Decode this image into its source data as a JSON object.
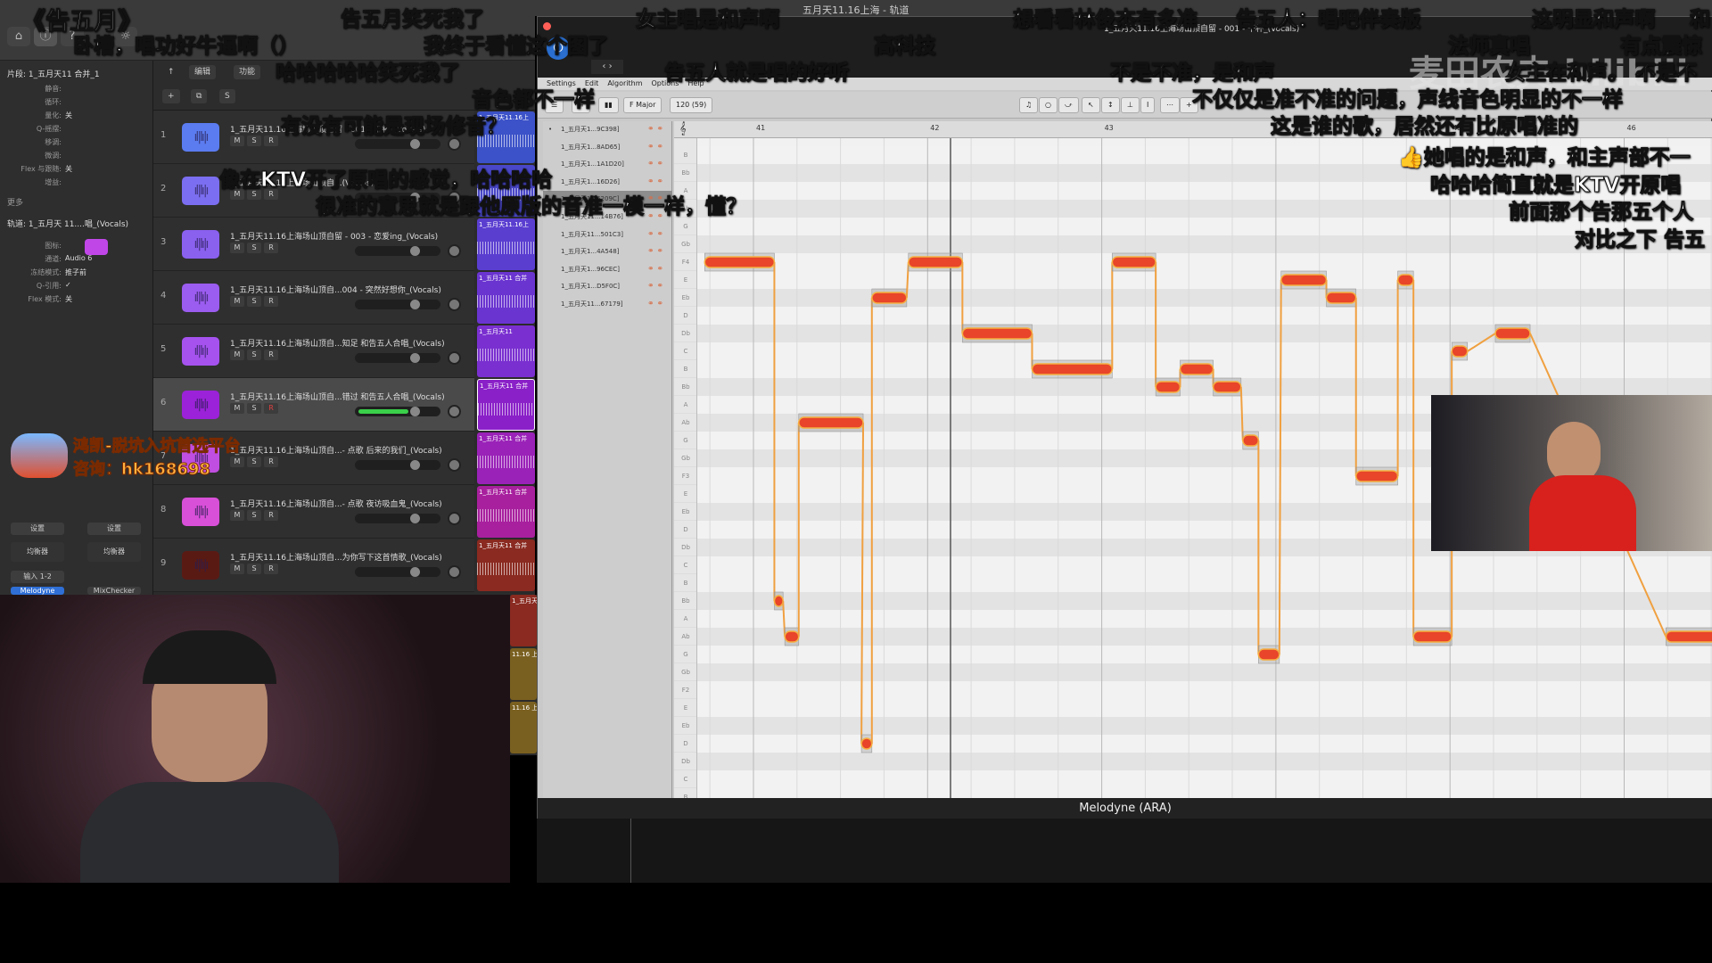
{
  "logic": {
    "window_title": "五月天11.16上海 - 轨道",
    "toolbar": {
      "edit": "编辑",
      "functions": "功能",
      "add": "+",
      "duplicate": "⧉",
      "solo": "S"
    },
    "inspector": {
      "region_header": "片段: 1_五月天11 合并_1",
      "region_rows": [
        {
          "label": "静音:",
          "value": ""
        },
        {
          "label": "循环:",
          "value": ""
        },
        {
          "label": "量化:",
          "value": "关"
        },
        {
          "label": "Q-摇摆:",
          "value": ""
        },
        {
          "label": "移调:",
          "value": ""
        },
        {
          "label": "微调:",
          "value": ""
        },
        {
          "label": "Flex 与跟随:",
          "value": "关"
        },
        {
          "label": "增益:",
          "value": ""
        }
      ],
      "more": "更多",
      "track_header": "轨道: 1_五月天 11....唱_(Vocals)",
      "track_rows": [
        {
          "label": "图标:",
          "value": ""
        },
        {
          "label": "通道:",
          "value": "Audio 6"
        },
        {
          "label": "冻结模式:",
          "value": "推子前"
        },
        {
          "label": "Q-引用:",
          "value": "✓"
        },
        {
          "label": "Flex 模式:",
          "value": "关"
        }
      ],
      "strip_left": {
        "settings": "设置",
        "eq": "均衡器",
        "input": "输入 1-2",
        "plugin": "Melodyne"
      },
      "strip_right": {
        "settings": "设置",
        "eq": "均衡器",
        "plugin": "MixChecker"
      }
    },
    "tracks": [
      {
        "num": "1",
        "name": "1_五月天11.16上海场山顶自留 - 001 - 干杯_(Vocals)",
        "color": "#5b7cf0",
        "region": "1_五月天11.16上",
        "region_color": "#3c52c8"
      },
      {
        "num": "2",
        "name": "1_五月天11.16上海场山顶自...(Vocals)",
        "color": "#7b6ef0",
        "region": "",
        "region_color": "#4a48c8"
      },
      {
        "num": "3",
        "name": "1_五月天11.16上海场山顶自留 - 003 - 恋爱ing_(Vocals)",
        "color": "#8a60ef",
        "region": "1_五月天11.16上",
        "region_color": "#5a3ed0"
      },
      {
        "num": "4",
        "name": "1_五月天11.16上海场山顶自...004 - 突然好想你_(Vocals)",
        "color": "#9b5cf0",
        "region": "1_五月天11 合并",
        "region_color": "#6a34d0"
      },
      {
        "num": "5",
        "name": "1_五月天11.16上海场山顶自...知足 和告五人合唱_(Vocals)",
        "color": "#a552ef",
        "region": "1_五月天11",
        "region_color": "#7a30d0"
      },
      {
        "num": "6",
        "name": "1_五月天11.16上海场山顶自...错过 和告五人合唱_(Vocals)",
        "color": "#9b22d8",
        "region": "1_五月天11 合并",
        "region_color": "#8a20c8",
        "selected": true,
        "level": 0.65
      },
      {
        "num": "7",
        "name": "1_五月天11.16上海场山顶自...- 点歌 后来的我们_(Vocals)",
        "color": "#c04ee0",
        "region": "1_五月天11 合并",
        "region_color": "#9a22b8"
      },
      {
        "num": "8",
        "name": "1_五月天11.16上海场山顶自...- 点歌 夜访吸血鬼_(Vocals)",
        "color": "#d84fd8",
        "region": "1_五月天11 合并",
        "region_color": "#a8209e"
      },
      {
        "num": "9",
        "name": "1_五月天11.16上海场山顶自...为你写下这首情歌_(Vocals)",
        "color": "#5a1a14",
        "region": "1_五月天11 合并",
        "region_color": "#8a2a20"
      }
    ],
    "track_buttons": {
      "mute": "M",
      "solo": "S",
      "record": "R"
    },
    "extra_regions": [
      "1_五月天11 合并",
      "11.16 上",
      "11.16 上"
    ]
  },
  "melodyne": {
    "window_title": "1_五月天11.16上海场山顶自留 - 001 - 干杯_(Vocals)",
    "menu": [
      "Settings",
      "Edit",
      "Algorithm",
      "Options",
      "Help"
    ],
    "key": "F Major",
    "tempo": "120 (59)",
    "status": "Melodyne (ARA)",
    "blobs": [
      "1_五月天1...9C398]",
      "1_五月天1...8AD65]",
      "1_五月天1...1A1D20]",
      "1_五月天1...16D26]",
      "1_五月天1...6209C]",
      "1_五月天11...14B76]",
      "1_五月天11...501C3]",
      "1_五月天1...4A548]",
      "1_五月天1...96CEC]",
      "1_五月天1...D5F0C]",
      "1_五月天11...67179]"
    ],
    "selected_blob": 4,
    "bars": [
      "41",
      "42",
      "43",
      "44",
      "45",
      "46"
    ],
    "note_color": "#e8452a",
    "notes": [
      {
        "start": 40.72,
        "end": 41.12,
        "pitch": "F4"
      },
      {
        "start": 41.12,
        "end": 41.17,
        "pitch": "Bb2"
      },
      {
        "start": 41.18,
        "end": 41.26,
        "pitch": "Ab2"
      },
      {
        "start": 41.26,
        "end": 41.63,
        "pitch": "Ab3"
      },
      {
        "start": 41.62,
        "end": 41.68,
        "pitch": "D2"
      },
      {
        "start": 41.68,
        "end": 41.88,
        "pitch": "Eb4"
      },
      {
        "start": 41.89,
        "end": 42.2,
        "pitch": "F4"
      },
      {
        "start": 42.2,
        "end": 42.6,
        "pitch": "Db4"
      },
      {
        "start": 42.6,
        "end": 43.06,
        "pitch": "B3"
      },
      {
        "start": 43.06,
        "end": 43.31,
        "pitch": "F4"
      },
      {
        "start": 43.31,
        "end": 43.45,
        "pitch": "Bb3"
      },
      {
        "start": 43.45,
        "end": 43.64,
        "pitch": "B3"
      },
      {
        "start": 43.64,
        "end": 43.8,
        "pitch": "Bb3"
      },
      {
        "start": 43.81,
        "end": 43.9,
        "pitch": "G3"
      },
      {
        "start": 43.9,
        "end": 44.02,
        "pitch": "G2"
      },
      {
        "start": 44.03,
        "end": 44.29,
        "pitch": "E4"
      },
      {
        "start": 44.29,
        "end": 44.46,
        "pitch": "Eb4"
      },
      {
        "start": 44.46,
        "end": 44.7,
        "pitch": "F3"
      },
      {
        "start": 44.7,
        "end": 44.79,
        "pitch": "E4"
      },
      {
        "start": 44.79,
        "end": 45.01,
        "pitch": "Ab2"
      },
      {
        "start": 45.01,
        "end": 45.1,
        "pitch": "C4"
      },
      {
        "start": 45.26,
        "end": 45.46,
        "pitch": "Db4"
      },
      {
        "start": 46.24,
        "end": 46.6,
        "pitch": "Ab2"
      }
    ]
  },
  "overlay": {
    "watermark": "麦田农夫 bilibili",
    "ad_line1": "鸿凯-脱坑入坑首选平台",
    "ad_line2": "咨询：hk168698",
    "comments": [
      "《告五月》",
      "告五月笑死我了",
      "女主唱是和声啊",
      "想看看林俊杰有多准",
      "告五人：唱吧伴奏版",
      "这明显和声啊",
      "和",
      "卧槽，唱功好牛逼啊（）",
      "我终于看懂这个图了",
      "高科技",
      "法师真唱",
      "有点震惊",
      "哈哈哈哈哈笑死我了",
      "告五人就是唱的好听",
      "不是不准，是和声",
      "女主在和声。 不是不",
      "音色都不一样",
      "不仅仅是准不准的问题，声线音色明显的不一样",
      "有没有可能是现场修音？",
      "这是谁的歌，居然还有比原唱准的",
      "👍她唱的是和声，和主声部不一",
      "像在KTV开了原唱的感觉，哈哈哈哈",
      "哈哈哈简直就是KTV开原唱",
      "很准的意思就是跟他原版的音准一模一样，懂？",
      "前面那个告那五个人",
      "对比之下 告五"
    ]
  }
}
